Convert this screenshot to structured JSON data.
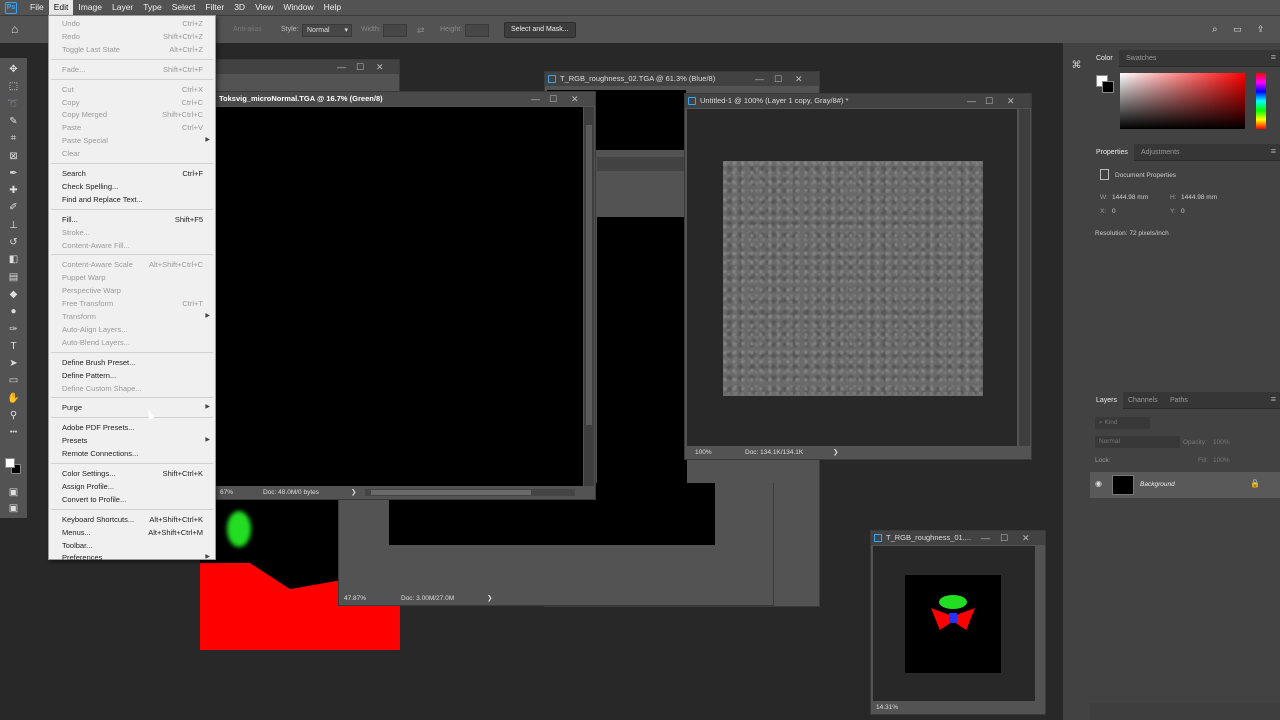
{
  "menubar": [
    "File",
    "Edit",
    "Image",
    "Layer",
    "Type",
    "Select",
    "Filter",
    "3D",
    "View",
    "Window",
    "Help"
  ],
  "options": {
    "anti_alias": "Anti-alias",
    "style_label": "Style:",
    "style_value": "Normal",
    "width_label": "Width:",
    "height_label": "Height:",
    "select_mask": "Select and Mask..."
  },
  "edit_menu": [
    {
      "label": "Undo",
      "shortcut": "Ctrl+Z",
      "enabled": false
    },
    {
      "label": "Redo",
      "shortcut": "Shift+Ctrl+Z",
      "enabled": false
    },
    {
      "label": "Toggle Last State",
      "shortcut": "Alt+Ctrl+Z",
      "enabled": false
    },
    {
      "sep": true
    },
    {
      "label": "Fade...",
      "shortcut": "Shift+Ctrl+F",
      "enabled": false
    },
    {
      "sep": true
    },
    {
      "label": "Cut",
      "shortcut": "Ctrl+X",
      "enabled": false
    },
    {
      "label": "Copy",
      "shortcut": "Ctrl+C",
      "enabled": false
    },
    {
      "label": "Copy Merged",
      "shortcut": "Shift+Ctrl+C",
      "enabled": false
    },
    {
      "label": "Paste",
      "shortcut": "Ctrl+V",
      "enabled": false
    },
    {
      "label": "Paste Special",
      "shortcut": "",
      "enabled": false,
      "sub": true
    },
    {
      "label": "Clear",
      "shortcut": "",
      "enabled": false
    },
    {
      "sep": true
    },
    {
      "label": "Search",
      "shortcut": "Ctrl+F",
      "enabled": true
    },
    {
      "label": "Check Spelling...",
      "shortcut": "",
      "enabled": true
    },
    {
      "label": "Find and Replace Text...",
      "shortcut": "",
      "enabled": true
    },
    {
      "sep": true
    },
    {
      "label": "Fill...",
      "shortcut": "Shift+F5",
      "enabled": true
    },
    {
      "label": "Stroke...",
      "shortcut": "",
      "enabled": false
    },
    {
      "label": "Content-Aware Fill...",
      "shortcut": "",
      "enabled": false
    },
    {
      "sep": true
    },
    {
      "label": "Content-Aware Scale",
      "shortcut": "Alt+Shift+Ctrl+C",
      "enabled": false
    },
    {
      "label": "Puppet Warp",
      "shortcut": "",
      "enabled": false
    },
    {
      "label": "Perspective Warp",
      "shortcut": "",
      "enabled": false
    },
    {
      "label": "Free Transform",
      "shortcut": "Ctrl+T",
      "enabled": false
    },
    {
      "label": "Transform",
      "shortcut": "",
      "enabled": false,
      "sub": true
    },
    {
      "label": "Auto-Align Layers...",
      "shortcut": "",
      "enabled": false
    },
    {
      "label": "Auto-Blend Layers...",
      "shortcut": "",
      "enabled": false
    },
    {
      "sep": true
    },
    {
      "label": "Define Brush Preset...",
      "shortcut": "",
      "enabled": true
    },
    {
      "label": "Define Pattern...",
      "shortcut": "",
      "enabled": true
    },
    {
      "label": "Define Custom Shape...",
      "shortcut": "",
      "enabled": false
    },
    {
      "sep": true
    },
    {
      "label": "Purge",
      "shortcut": "",
      "enabled": true,
      "sub": true
    },
    {
      "sep": true
    },
    {
      "label": "Adobe PDF Presets...",
      "shortcut": "",
      "enabled": true
    },
    {
      "label": "Presets",
      "shortcut": "",
      "enabled": true,
      "sub": true
    },
    {
      "label": "Remote Connections...",
      "shortcut": "",
      "enabled": true
    },
    {
      "sep": true
    },
    {
      "label": "Color Settings...",
      "shortcut": "Shift+Ctrl+K",
      "enabled": true
    },
    {
      "label": "Assign Profile...",
      "shortcut": "",
      "enabled": true
    },
    {
      "label": "Convert to Profile...",
      "shortcut": "",
      "enabled": true
    },
    {
      "sep": true
    },
    {
      "label": "Keyboard Shortcuts...",
      "shortcut": "Alt+Shift+Ctrl+K",
      "enabled": true
    },
    {
      "label": "Menus...",
      "shortcut": "Alt+Shift+Ctrl+M",
      "enabled": true
    },
    {
      "label": "Toolbar...",
      "shortcut": "",
      "enabled": true
    },
    {
      "label": "Preferences",
      "shortcut": "",
      "enabled": true,
      "sub": true
    }
  ],
  "windows": {
    "w1_title": "T_RGB_roughness_02.TGA @ 61.3% (Blue/8)",
    "w2_title": "Toksvig_microNormal.TGA @ 16.7% (Green/8)",
    "w2_zoom": "67%",
    "w2_doc": "Doc: 48.0M/0 bytes",
    "w3_title": "Untitled-1 @ 100% (Layer 1 copy, Gray/8#) *",
    "w3_zoom": "100%",
    "w3_doc": "Doc: 134.1K/134.1K",
    "w4_zoom": "47.87%",
    "w4_doc": "Doc: 3.00M/27.0M",
    "w5_title": "T_RGB_roughness_01....",
    "w5_zoom": "14.31%",
    "w0_title": ") *"
  },
  "panels": {
    "color_tab": "Color",
    "swatches_tab": "Swatches",
    "properties_tab": "Properties",
    "adjustments_tab": "Adjustments",
    "doc_props": "Document Properties",
    "w_label": "W:",
    "w_value": "1444.98 mm",
    "h_label": "H:",
    "h_value": "1444.98 mm",
    "x_label": "X:",
    "x_value": "0",
    "y_label": "Y:",
    "y_value": "0",
    "resolution": "Resolution: 72 pixels/inch",
    "layers_tab": "Layers",
    "channels_tab": "Channels",
    "paths_tab": "Paths",
    "kind": "Kind",
    "blend": "Normal",
    "opacity_label": "Opacity:",
    "opacity_value": "100%",
    "lock_label": "Lock:",
    "fill_label": "Fill:",
    "fill_value": "100%",
    "layer_name": "Background"
  },
  "colors": {
    "accent": "#31a8ff",
    "menu_bg": "#f0f0f0",
    "panel_bg": "#424242",
    "app_bg": "#282828"
  }
}
